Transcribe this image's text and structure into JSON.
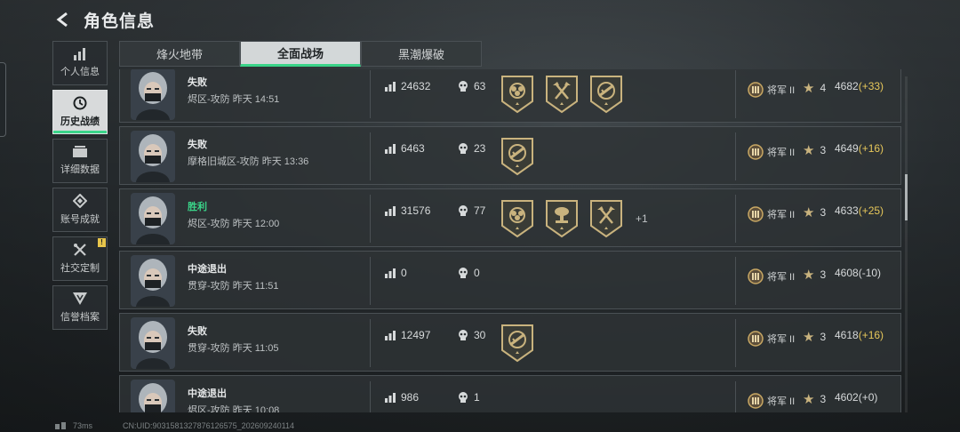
{
  "header": {
    "title": "角色信息"
  },
  "sidebar": {
    "items": [
      {
        "label": "个人信息",
        "icon": "bar-chart-icon"
      },
      {
        "label": "历史战绩",
        "icon": "clock-icon"
      },
      {
        "label": "详细数据",
        "icon": "folder-icon"
      },
      {
        "label": "账号成就",
        "icon": "achievement-icon"
      },
      {
        "label": "社交定制",
        "icon": "tools-icon"
      },
      {
        "label": "信誉档案",
        "icon": "shield-icon"
      }
    ],
    "active_index": 1,
    "badge": "!"
  },
  "tabs": [
    {
      "label": "烽火地带"
    },
    {
      "label": "全面战场"
    },
    {
      "label": "黑潮爆破"
    }
  ],
  "active_tab": 1,
  "matches": [
    {
      "result": "失败",
      "map": "烬区-攻防 昨天 14:51",
      "score": "24632",
      "kills": "63",
      "medals": [
        "roses",
        "axes",
        "rifle"
      ],
      "extra": "",
      "rank": "将军 II",
      "stars": "4",
      "points": "4682",
      "delta": "(+33)"
    },
    {
      "result": "失败",
      "map": "摩格旧城区-攻防 昨天 13:36",
      "score": "6463",
      "kills": "23",
      "medals": [
        "rifle"
      ],
      "extra": "",
      "rank": "将军 II",
      "stars": "3",
      "points": "4649",
      "delta": "(+16)"
    },
    {
      "result": "胜利",
      "map": "烬区-攻防 昨天 12:00",
      "score": "31576",
      "kills": "77",
      "medals": [
        "roses",
        "blast",
        "axes"
      ],
      "extra": "+1",
      "rank": "将军 II",
      "stars": "3",
      "points": "4633",
      "delta": "(+25)"
    },
    {
      "result": "中途退出",
      "map": "贯穿-攻防 昨天 11:51",
      "score": "0",
      "kills": "0",
      "medals": [],
      "extra": "",
      "rank": "将军 II",
      "stars": "3",
      "points": "4608",
      "delta": "(-10)"
    },
    {
      "result": "失败",
      "map": "贯穿-攻防 昨天 11:05",
      "score": "12497",
      "kills": "30",
      "medals": [
        "rifle"
      ],
      "extra": "",
      "rank": "将军 II",
      "stars": "3",
      "points": "4618",
      "delta": "(+16)"
    },
    {
      "result": "中途退出",
      "map": "烬区-攻防 昨天 10:08",
      "score": "986",
      "kills": "1",
      "medals": [],
      "extra": "",
      "rank": "将军 II",
      "stars": "3",
      "points": "4602",
      "delta": "(+0)"
    }
  ],
  "footer": {
    "ping": "73ms",
    "uid": "CN:UID:9031581327876126575_202609240114"
  },
  "colors": {
    "win": "#3ad489",
    "delta": "#e6c75a",
    "accent": "#3ad489"
  }
}
